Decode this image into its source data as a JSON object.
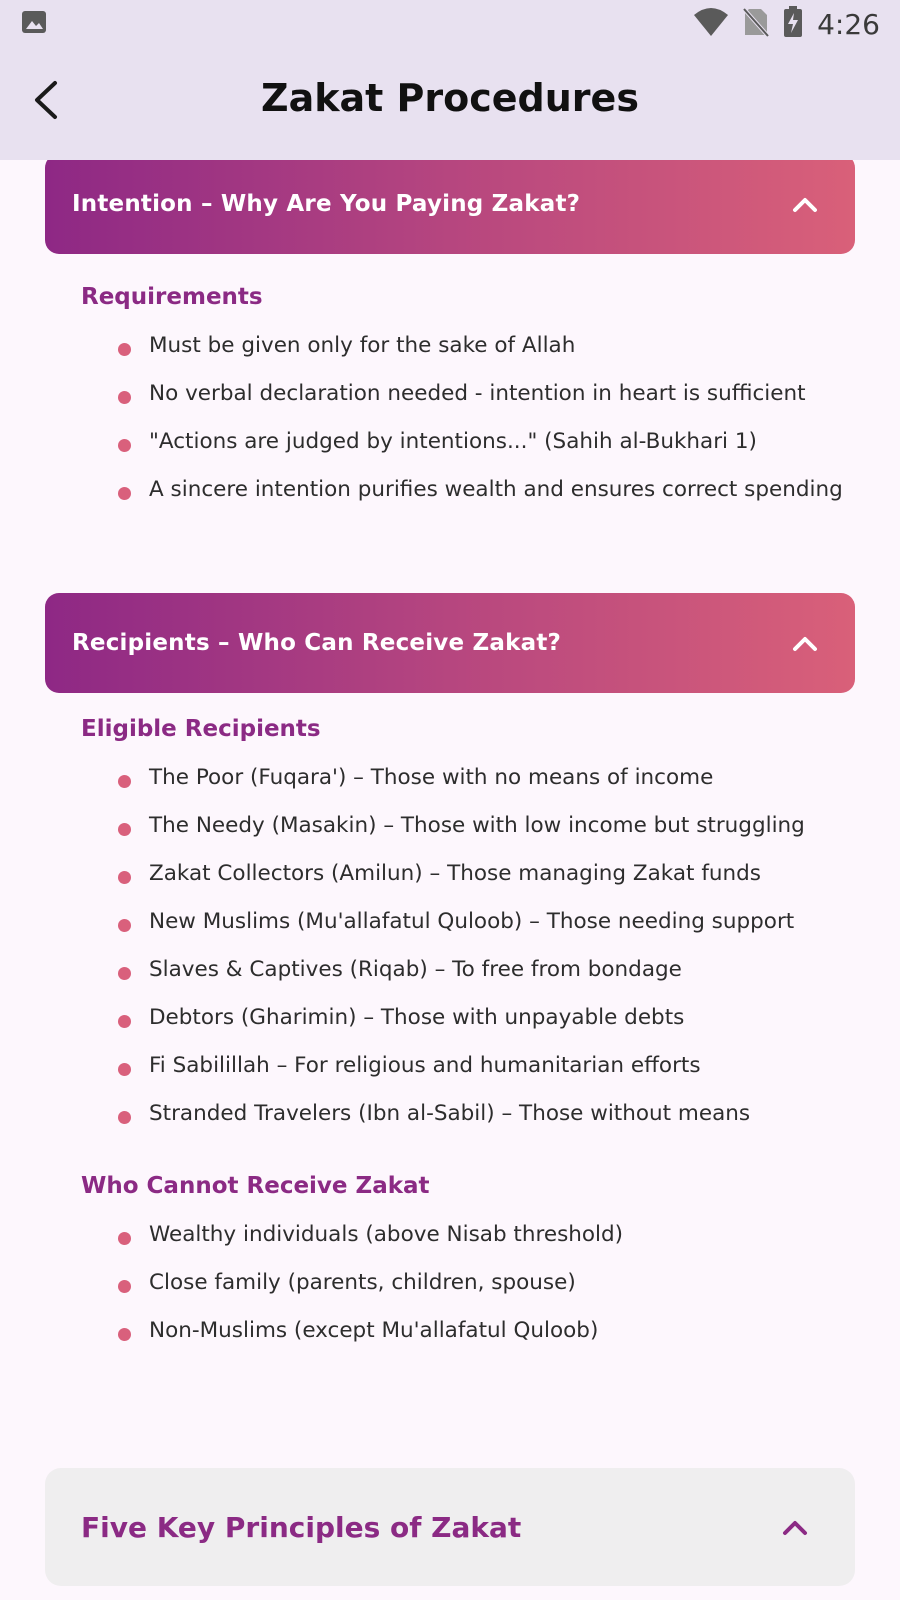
{
  "status_bar": {
    "time": "4:26",
    "icons": [
      "image-icon",
      "wifi-icon",
      "no-sim-icon",
      "battery-charging-icon"
    ]
  },
  "app_bar": {
    "title": "Zakat Procedures",
    "back_icon": "back-arrow-icon"
  },
  "sections": [
    {
      "title": "Intention – Why Are You Paying Zakat?",
      "expanded": true,
      "groups": [
        {
          "heading": "Requirements",
          "items": [
            "Must be given only for the sake of Allah",
            "No verbal declaration needed - intention in heart is sufficient",
            "\"Actions are judged by intentions...\" (Sahih al-Bukhari 1)",
            "A sincere intention purifies wealth and ensures correct spending"
          ]
        }
      ]
    },
    {
      "title": "Recipients – Who Can Receive Zakat?",
      "expanded": true,
      "groups": [
        {
          "heading": "Eligible Recipients",
          "items": [
            "The Poor (Fuqara') – Those with no means of income",
            "The Needy (Masakin) – Those with low income but struggling",
            "Zakat Collectors (Amilun) – Those managing Zakat funds",
            "New Muslims (Mu'allafatul Quloob) – Those needing support",
            "Slaves & Captives (Riqab) – To free from bondage",
            "Debtors (Gharimin) – Those with unpayable debts",
            "Fi Sabilillah – For religious and humanitarian efforts",
            "Stranded Travelers (Ibn al-Sabil) – Those without means"
          ]
        },
        {
          "heading": "Who Cannot Receive Zakat",
          "items": [
            "Wealthy individuals (above Nisab threshold)",
            "Close family (parents, children, spouse)",
            "Non-Muslims (except Mu'allafatul Quloob)"
          ]
        }
      ]
    }
  ],
  "collapsed_card": {
    "title": "Five Key Principles of Zakat"
  },
  "colors": {
    "accent": "#8b2a84",
    "gradient_start": "#8e2885",
    "gradient_end": "#d96079",
    "bullet": "#d9607c",
    "appbar_bg": "#e8e1f0",
    "page_bg": "#fdf7fd"
  }
}
